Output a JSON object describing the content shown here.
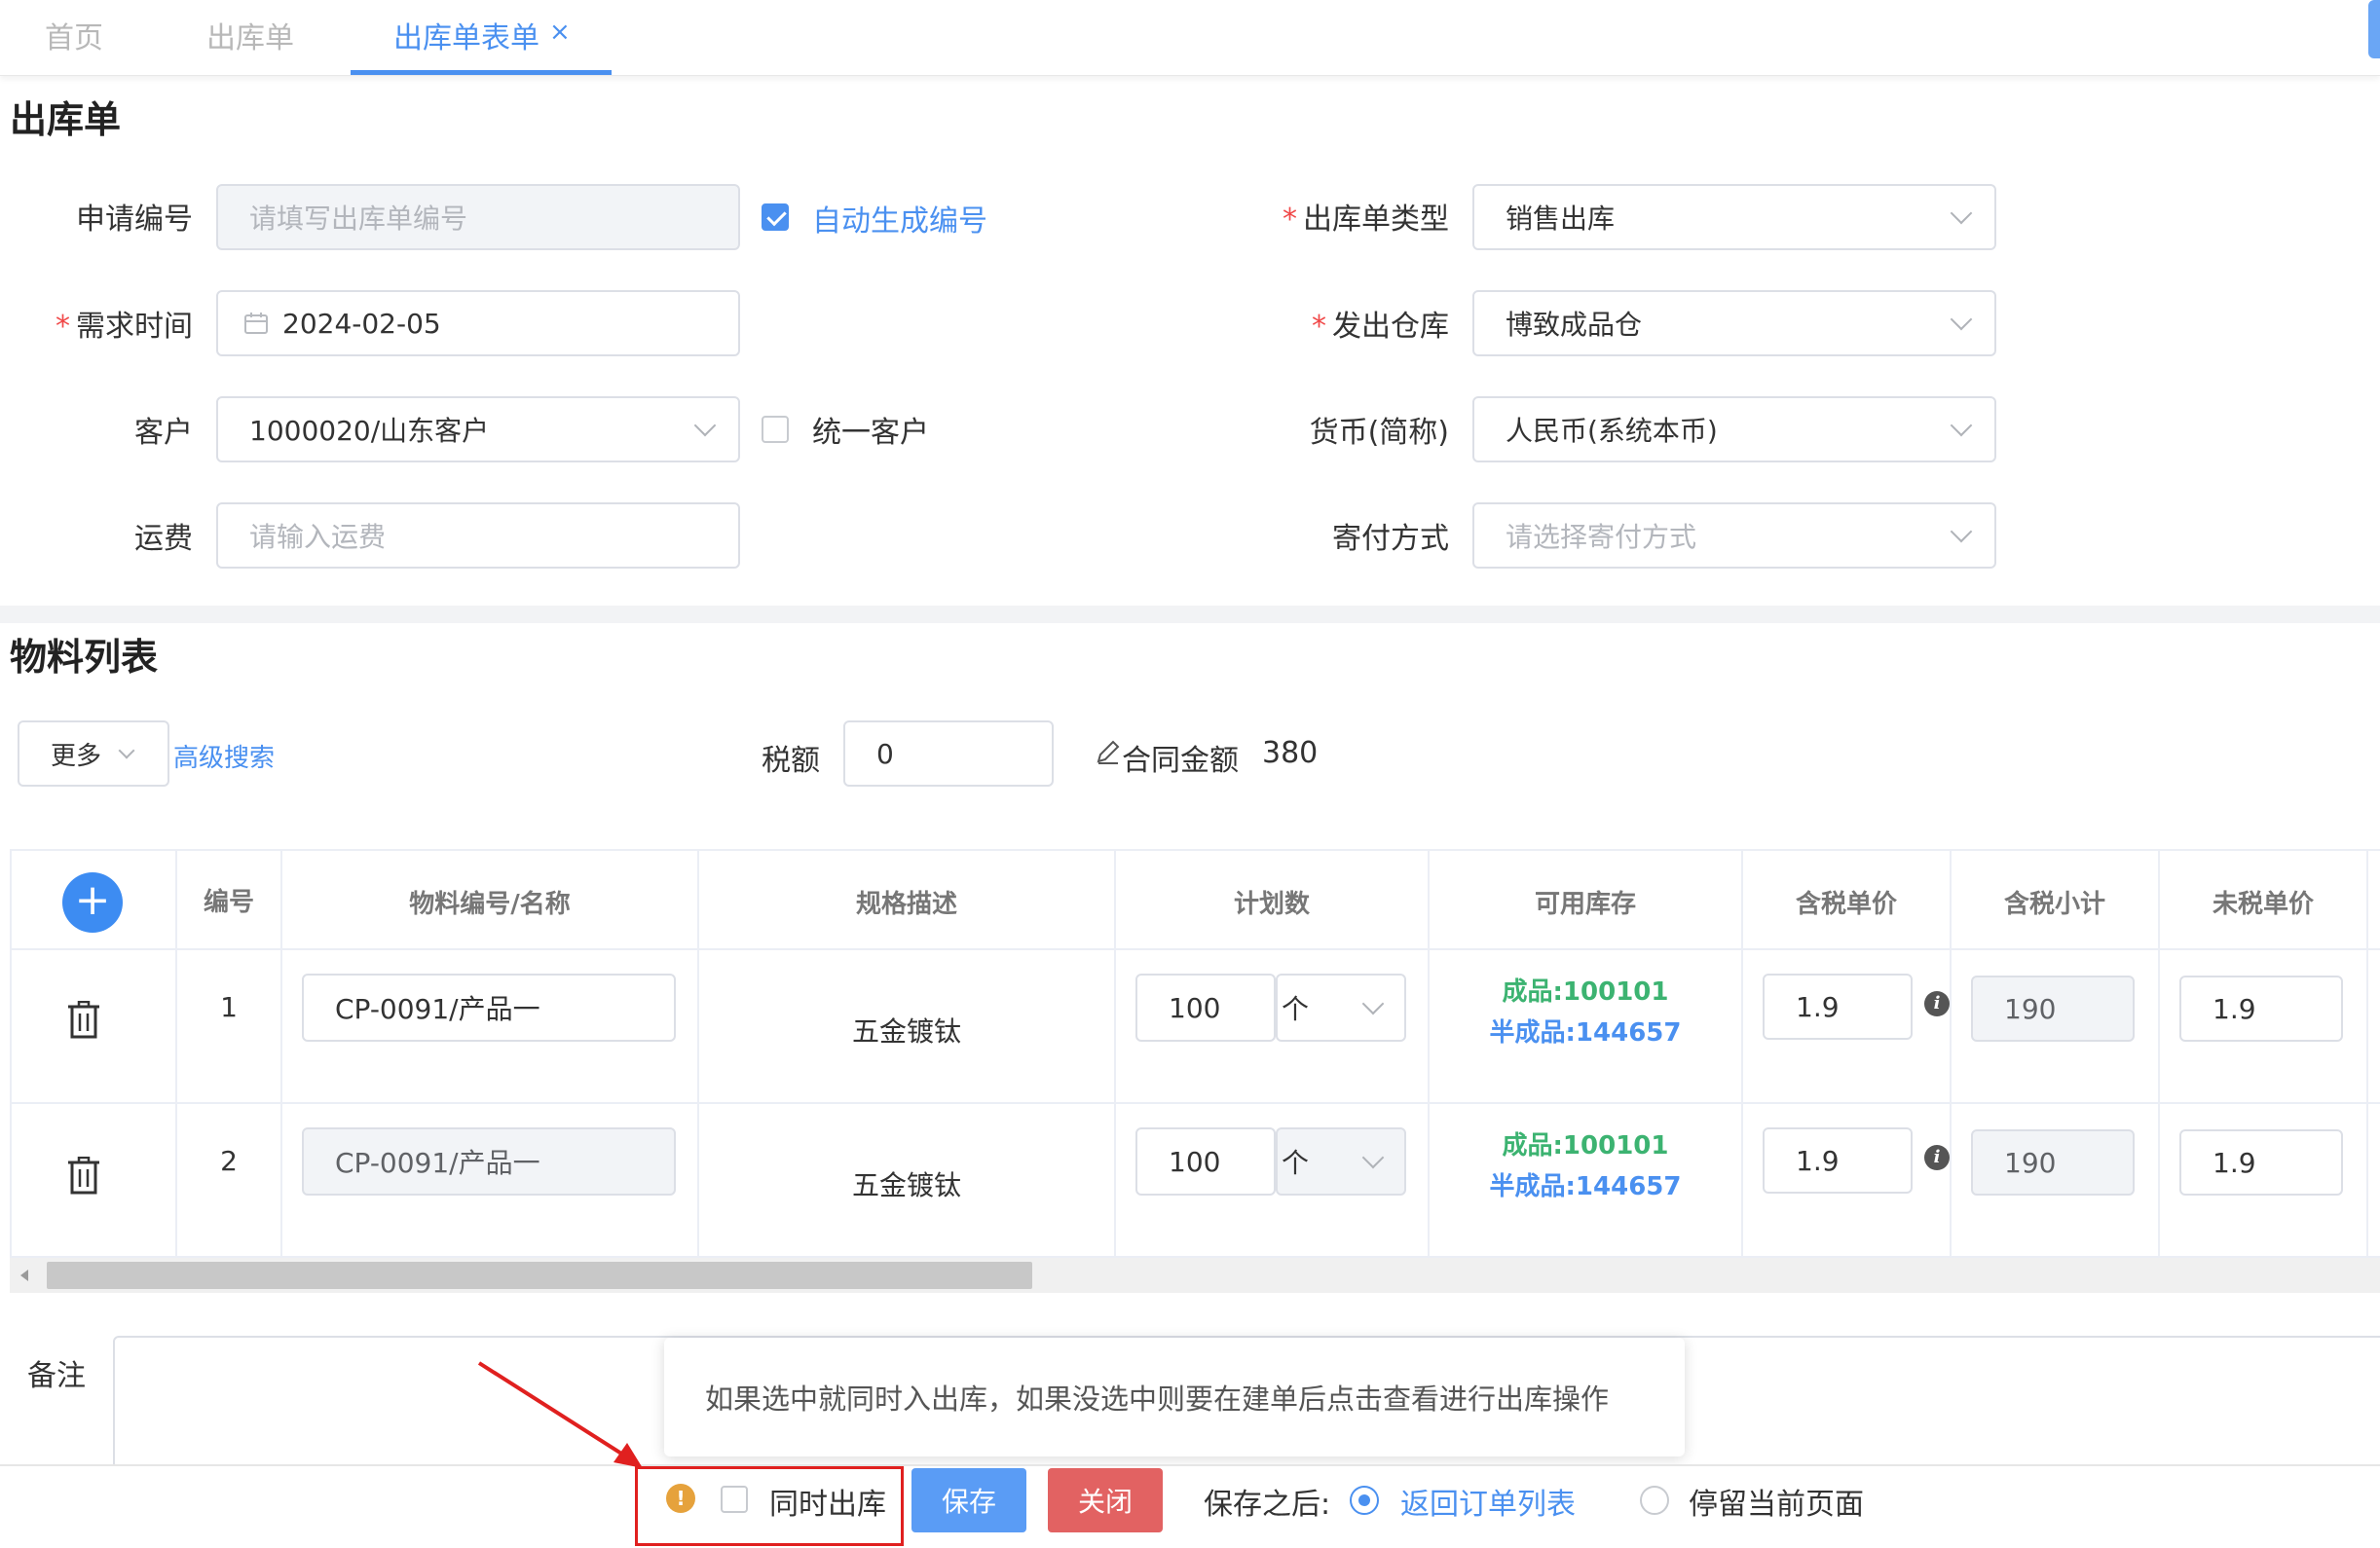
{
  "tabs": [
    {
      "label": "首页"
    },
    {
      "label": "出库单"
    },
    {
      "label": "出库单表单",
      "close": "×"
    }
  ],
  "form": {
    "title": "出库单",
    "apply_no": {
      "label": "申请编号",
      "placeholder": "请填写出库单编号",
      "auto_label": "自动生成编号",
      "auto_checked": true
    },
    "out_type": {
      "label": "出库单类型",
      "value": "销售出库"
    },
    "need_time": {
      "label": "需求时间",
      "value": "2024-02-05"
    },
    "warehouse": {
      "label": "发出仓库",
      "value": "博致成品仓"
    },
    "customer": {
      "label": "客户",
      "value": "1000020/山东客户",
      "unify_label": "统一客户",
      "unify_checked": false
    },
    "currency": {
      "label": "货币(简称)",
      "value": "人民币(系统本币)"
    },
    "freight": {
      "label": "运费",
      "placeholder": "请输入运费"
    },
    "ship_method": {
      "label": "寄付方式",
      "placeholder": "请选择寄付方式"
    }
  },
  "materials": {
    "title": "物料列表",
    "more_label": "更多",
    "adv_search": "高级搜索",
    "tax_label": "税额",
    "tax_value": "0",
    "contract_label": "合同金额",
    "contract_value": "380",
    "columns": [
      "编号",
      "物料编号/名称",
      "规格描述",
      "计划数",
      "可用库存",
      "含税单价",
      "含税小计",
      "未税单价"
    ],
    "add_symbol": "+",
    "rows": [
      {
        "no": "1",
        "material": "CP-0091/产品一",
        "spec": "五金镀钛",
        "qty": "100",
        "unit": "个",
        "stock_finished_label": "成品:",
        "stock_finished": "100101",
        "stock_semi_label": "半成品:",
        "stock_semi": "144657",
        "tax_price": "1.9",
        "subtotal": "190",
        "untaxed_price": "1.9"
      },
      {
        "no": "2",
        "material": "CP-0091/产品一",
        "spec": "五金镀钛",
        "qty": "100",
        "unit": "个",
        "stock_finished_label": "成品:",
        "stock_finished": "100101",
        "stock_semi_label": "半成品:",
        "stock_semi": "144657",
        "tax_price": "1.9",
        "subtotal": "190",
        "untaxed_price": "1.9"
      }
    ]
  },
  "remark": {
    "label": "备注"
  },
  "tooltip": "如果选中就同时入出库，如果没选中则要在建单后点击查看进行出库操作",
  "footer": {
    "warn_symbol": "!",
    "sync_label": "同时出库",
    "save": "保存",
    "close": "关闭",
    "after_save_label": "保存之后:",
    "option_return": "返回订单列表",
    "option_stay": "停留当前页面"
  },
  "colors": {
    "primary": "#4a90f0",
    "danger": "#e26262",
    "success": "#3cb371",
    "warning": "#e6a23c",
    "annotation": "#e0201f"
  }
}
